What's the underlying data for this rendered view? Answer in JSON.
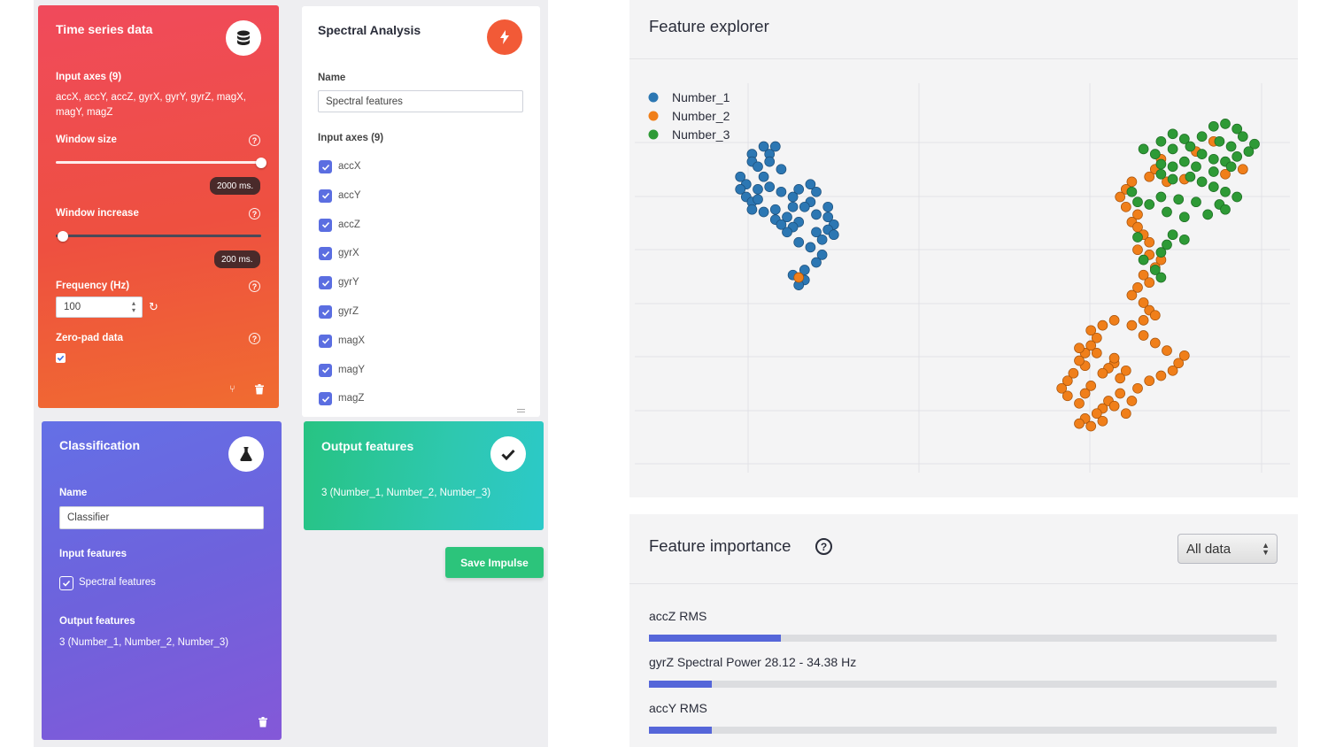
{
  "time_series": {
    "title": "Time series data",
    "icon": "database-icon",
    "input_axes_label": "Input axes (9)",
    "input_axes_value_line1": "accX, accY, accZ, gyrX, gyrY, gyrZ, magX,",
    "input_axes_value_line2": "magY, magZ",
    "window_size_label": "Window size",
    "window_size_value": "2000 ms.",
    "window_size_fraction": 1.0,
    "window_increase_label": "Window increase",
    "window_increase_value": "200 ms.",
    "window_increase_fraction": 0.0,
    "frequency_label": "Frequency (Hz)",
    "frequency_value": "100",
    "zero_pad_label": "Zero-pad data",
    "zero_pad_checked": true
  },
  "spectral": {
    "title": "Spectral Analysis",
    "icon": "lightning-icon",
    "name_label": "Name",
    "name_value": "Spectral features",
    "input_axes_label": "Input axes (9)",
    "axes": [
      "accX",
      "accY",
      "accZ",
      "gyrX",
      "gyrY",
      "gyrZ",
      "magX",
      "magY",
      "magZ"
    ]
  },
  "classification": {
    "title": "Classification",
    "icon": "flask-icon",
    "name_label": "Name",
    "name_value": "Classifier",
    "input_features_label": "Input features",
    "input_feature": "Spectral features",
    "output_features_label": "Output features",
    "output_features_value": "3 (Number_1, Number_2, Number_3)"
  },
  "output": {
    "title": "Output features",
    "icon": "check-icon",
    "value": "3 (Number_1, Number_2, Number_3)"
  },
  "save_button": "Save Impulse",
  "feature_explorer": {
    "title": "Feature explorer"
  },
  "feature_importance": {
    "title": "Feature importance",
    "select_value": "All data",
    "items": [
      {
        "label": "accZ RMS",
        "importance": 0.21
      },
      {
        "label": "gyrZ Spectral Power 28.12 - 34.38 Hz",
        "importance": 0.1
      },
      {
        "label": "accY RMS",
        "importance": 0.1
      }
    ]
  },
  "colors": {
    "number_1": "#2c77b3",
    "number_2": "#f07f1a",
    "number_3": "#2e9a36",
    "accent": "#5566d9"
  },
  "chart_data": {
    "type": "scatter",
    "legend_position": "top-left",
    "grid": true,
    "xlim": [
      0,
      100
    ],
    "ylim": [
      0,
      100
    ],
    "series": [
      {
        "name": "Number_1",
        "points": [
          [
            16,
            84
          ],
          [
            17,
            81
          ],
          [
            18,
            84
          ],
          [
            14,
            81
          ],
          [
            14,
            78
          ],
          [
            15,
            76
          ],
          [
            17,
            78
          ],
          [
            19,
            75
          ],
          [
            16,
            72
          ],
          [
            13,
            69
          ],
          [
            12,
            67
          ],
          [
            13,
            64
          ],
          [
            14,
            62
          ],
          [
            15,
            67
          ],
          [
            17,
            68
          ],
          [
            19,
            66
          ],
          [
            21,
            64
          ],
          [
            22,
            67
          ],
          [
            24,
            69
          ],
          [
            25,
            66
          ],
          [
            24,
            62
          ],
          [
            21,
            60
          ],
          [
            18,
            59
          ],
          [
            16,
            58
          ],
          [
            14,
            59
          ],
          [
            20,
            56
          ],
          [
            22,
            54
          ],
          [
            25,
            57
          ],
          [
            27,
            60
          ],
          [
            27,
            56
          ],
          [
            28,
            53
          ],
          [
            25,
            50
          ],
          [
            26,
            47
          ],
          [
            22,
            46
          ],
          [
            24,
            44
          ],
          [
            26,
            41
          ],
          [
            25,
            38
          ],
          [
            21,
            52
          ],
          [
            18,
            55
          ],
          [
            23,
            35
          ],
          [
            21,
            33
          ],
          [
            23,
            31
          ],
          [
            22,
            29
          ],
          [
            20,
            50
          ],
          [
            19,
            53
          ],
          [
            27,
            51
          ],
          [
            28,
            49
          ],
          [
            23,
            60
          ],
          [
            15,
            63
          ],
          [
            12,
            72
          ]
        ]
      },
      {
        "name": "Number_2",
        "points": [
          [
            22,
            32
          ],
          [
            90,
            82
          ],
          [
            93,
            86
          ],
          [
            98,
            75
          ],
          [
            95,
            73
          ],
          [
            88,
            71
          ],
          [
            84,
            79
          ],
          [
            83,
            75
          ],
          [
            82,
            72
          ],
          [
            85,
            70
          ],
          [
            79,
            70
          ],
          [
            78,
            67
          ],
          [
            77,
            64
          ],
          [
            78,
            60
          ],
          [
            80,
            57
          ],
          [
            79,
            54
          ],
          [
            80,
            52
          ],
          [
            81,
            49
          ],
          [
            82,
            46
          ],
          [
            80,
            43
          ],
          [
            82,
            41
          ],
          [
            84,
            39
          ],
          [
            83,
            36
          ],
          [
            81,
            33
          ],
          [
            82,
            30
          ],
          [
            80,
            28
          ],
          [
            79,
            25
          ],
          [
            81,
            22
          ],
          [
            82,
            19
          ],
          [
            83,
            17
          ],
          [
            81,
            15
          ],
          [
            79,
            13
          ],
          [
            76,
            15
          ],
          [
            74,
            13
          ],
          [
            72,
            11
          ],
          [
            73,
            8
          ],
          [
            72,
            5
          ],
          [
            71,
            2
          ],
          [
            70,
            4
          ],
          [
            73,
            2
          ],
          [
            76,
            -2
          ],
          [
            75,
            -4
          ],
          [
            74,
            -6
          ],
          [
            77,
            -8
          ],
          [
            78,
            -5
          ],
          [
            76,
            0
          ],
          [
            71,
            -3
          ],
          [
            70,
            -1
          ],
          [
            69,
            -6
          ],
          [
            68,
            -9
          ],
          [
            67,
            -12
          ],
          [
            68,
            -15
          ],
          [
            70,
            -18
          ],
          [
            71,
            -14
          ],
          [
            72,
            -11
          ],
          [
            74,
            -20
          ],
          [
            75,
            -17
          ],
          [
            77,
            -14
          ],
          [
            76,
            -19
          ],
          [
            73,
            -22
          ],
          [
            71,
            -24
          ],
          [
            70,
            -26
          ],
          [
            72,
            -27
          ],
          [
            74,
            -25
          ],
          [
            78,
            -22
          ],
          [
            79,
            -17
          ],
          [
            80,
            -12
          ],
          [
            82,
            -9
          ],
          [
            84,
            -7
          ],
          [
            86,
            -5
          ],
          [
            87,
            -2
          ],
          [
            88,
            1
          ],
          [
            85,
            3
          ],
          [
            83,
            6
          ],
          [
            81,
            9
          ]
        ]
      },
      {
        "name": "Number_3",
        "points": [
          [
            93,
            92
          ],
          [
            95,
            93
          ],
          [
            97,
            91
          ],
          [
            98,
            88
          ],
          [
            100,
            85
          ],
          [
            99,
            82
          ],
          [
            96,
            84
          ],
          [
            94,
            86
          ],
          [
            91,
            88
          ],
          [
            88,
            87
          ],
          [
            86,
            89
          ],
          [
            84,
            86
          ],
          [
            86,
            83
          ],
          [
            89,
            84
          ],
          [
            91,
            81
          ],
          [
            93,
            79
          ],
          [
            95,
            78
          ],
          [
            97,
            80
          ],
          [
            96,
            76
          ],
          [
            93,
            74
          ],
          [
            90,
            76
          ],
          [
            88,
            78
          ],
          [
            86,
            76
          ],
          [
            84,
            77
          ],
          [
            83,
            81
          ],
          [
            81,
            83
          ],
          [
            84,
            73
          ],
          [
            86,
            71
          ],
          [
            89,
            72
          ],
          [
            91,
            70
          ],
          [
            93,
            68
          ],
          [
            95,
            66
          ],
          [
            97,
            64
          ],
          [
            94,
            61
          ],
          [
            90,
            62
          ],
          [
            87,
            63
          ],
          [
            84,
            64
          ],
          [
            82,
            61
          ],
          [
            85,
            58
          ],
          [
            88,
            56
          ],
          [
            92,
            57
          ],
          [
            95,
            59
          ],
          [
            79,
            66
          ],
          [
            80,
            62
          ],
          [
            86,
            49
          ],
          [
            88,
            47
          ],
          [
            85,
            45
          ],
          [
            84,
            42
          ],
          [
            80,
            48
          ],
          [
            81,
            39
          ],
          [
            83,
            35
          ],
          [
            84,
            32
          ]
        ]
      }
    ]
  }
}
